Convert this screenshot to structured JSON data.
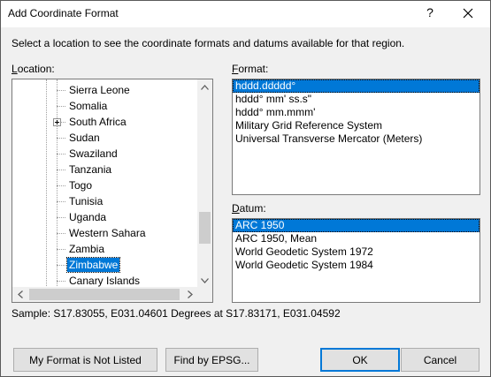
{
  "window": {
    "title": "Add Coordinate Format",
    "help_glyph": "?",
    "close_icon": "close-icon"
  },
  "instruction": "Select a location to see the coordinate formats and datums available for that region.",
  "location": {
    "label_access_key": "L",
    "label_rest": "ocation:",
    "items": [
      {
        "label": "Sierra Leone",
        "expandable": false,
        "selected": false
      },
      {
        "label": "Somalia",
        "expandable": false,
        "selected": false
      },
      {
        "label": "South Africa",
        "expandable": true,
        "selected": false
      },
      {
        "label": "Sudan",
        "expandable": false,
        "selected": false
      },
      {
        "label": "Swaziland",
        "expandable": false,
        "selected": false
      },
      {
        "label": "Tanzania",
        "expandable": false,
        "selected": false
      },
      {
        "label": "Togo",
        "expandable": false,
        "selected": false
      },
      {
        "label": "Tunisia",
        "expandable": false,
        "selected": false
      },
      {
        "label": "Uganda",
        "expandable": false,
        "selected": false
      },
      {
        "label": "Western Sahara",
        "expandable": false,
        "selected": false
      },
      {
        "label": "Zambia",
        "expandable": false,
        "selected": false
      },
      {
        "label": "Zimbabwe",
        "expandable": false,
        "selected": true
      },
      {
        "label": "Canary Islands",
        "expandable": false,
        "selected": false
      }
    ]
  },
  "format": {
    "label_access_key": "F",
    "label_rest": "ormat:",
    "items": [
      {
        "label": "hddd.ddddd°",
        "selected": true
      },
      {
        "label": "hddd° mm' ss.s\"",
        "selected": false
      },
      {
        "label": "hddd° mm.mmm'",
        "selected": false
      },
      {
        "label": "Military Grid Reference System",
        "selected": false
      },
      {
        "label": "Universal Transverse Mercator (Meters)",
        "selected": false
      }
    ]
  },
  "datum": {
    "label_access_key": "D",
    "label_rest": "atum:",
    "items": [
      {
        "label": "ARC 1950",
        "selected": true
      },
      {
        "label": "ARC 1950, Mean",
        "selected": false
      },
      {
        "label": "World Geodetic System 1972",
        "selected": false
      },
      {
        "label": "World Geodetic System 1984",
        "selected": false
      }
    ]
  },
  "sample": "Sample: S17.83055, E031.04601 Degrees at S17.83171, E031.04592",
  "buttons": {
    "not_listed": "My Format is Not Listed",
    "find_epsg": "Find by EPSG...",
    "ok": "OK",
    "cancel": "Cancel"
  },
  "colors": {
    "selection": "#0078d7",
    "dialog_bg": "#f0f0f0",
    "button_bg": "#e1e1e1"
  }
}
